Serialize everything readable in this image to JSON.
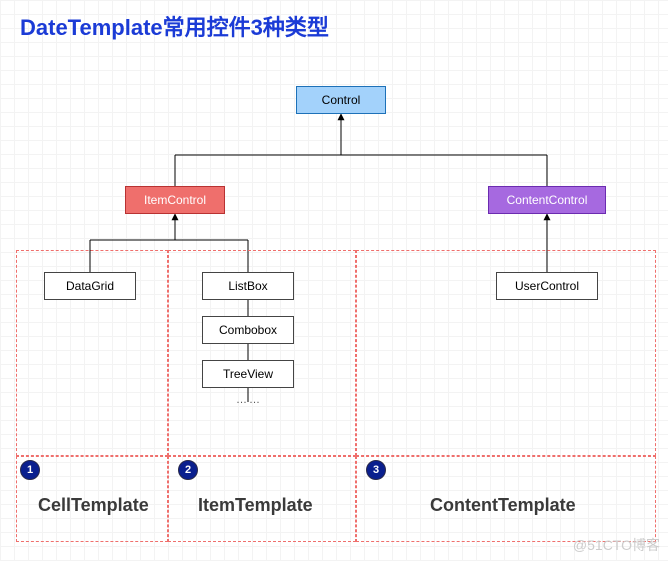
{
  "title": "DateTemplate常用控件3种类型",
  "nodes": {
    "control": "Control",
    "itemControl": "ItemControl",
    "contentControl": "ContentControl",
    "dataGrid": "DataGrid",
    "listBox": "ListBox",
    "combobox": "Combobox",
    "treeView": "TreeView",
    "ellipsis": "……",
    "userControl": "UserControl"
  },
  "groups": {
    "g1": {
      "badge": "1",
      "label": "CellTemplate"
    },
    "g2": {
      "badge": "2",
      "label": "ItemTemplate"
    },
    "g3": {
      "badge": "3",
      "label": "ContentTemplate"
    }
  },
  "watermark": "@51CTO博客",
  "colors": {
    "titleBlue": "#1b3bd6",
    "nodeBlue": "#a3d2fb",
    "nodeRed": "#ef6f6c",
    "nodePurple": "#a669e0",
    "badgeNavy": "#0a1f8e",
    "dashRed": "#ef6f6c"
  }
}
